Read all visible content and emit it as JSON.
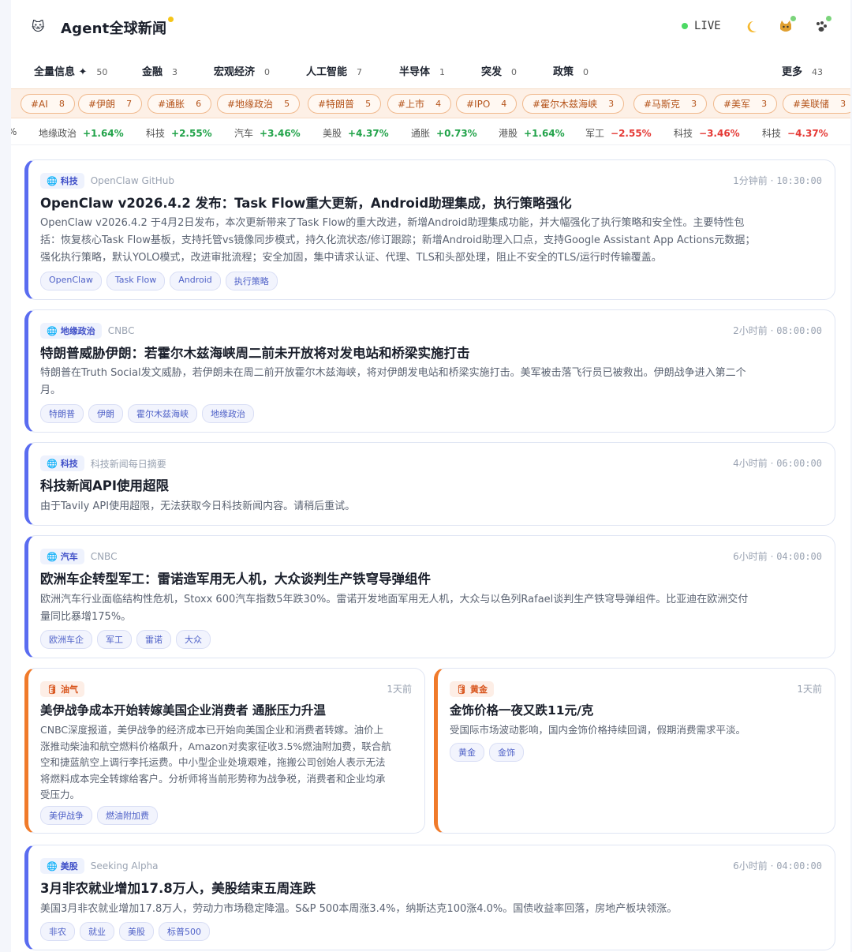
{
  "header": {
    "logo_icon": "🐱",
    "title": "Agent全球新闻",
    "live_label": "LIVE",
    "icons": [
      "moon-icon",
      "cat-icon",
      "paw-icon"
    ]
  },
  "categories": [
    {
      "label": "全量信息 ✦",
      "count": "50"
    },
    {
      "label": "金融",
      "count": "3"
    },
    {
      "label": "宏观经济",
      "count": "0"
    },
    {
      "label": "人工智能",
      "count": "7"
    },
    {
      "label": "半导体",
      "count": "1"
    },
    {
      "label": "突发",
      "count": "0"
    },
    {
      "label": "政策",
      "count": "0"
    },
    {
      "label": "更多",
      "count": "43"
    }
  ],
  "hashtags": [
    {
      "label": "#AI",
      "count": "8"
    },
    {
      "label": "#伊朗",
      "count": "7"
    },
    {
      "label": "#通胀",
      "count": "6"
    },
    {
      "label": "#地缘政治",
      "count": "5"
    },
    {
      "label": "#特朗普",
      "count": "5"
    },
    {
      "label": "#上市",
      "count": "4"
    },
    {
      "label": "#IPO",
      "count": "4"
    },
    {
      "label": "#霍尔木兹海峡",
      "count": "3"
    },
    {
      "label": "#马斯克",
      "count": "3"
    },
    {
      "label": "#美军",
      "count": "3"
    },
    {
      "label": "#美联储",
      "count": "3"
    }
  ],
  "ticker": [
    {
      "name": "%",
      "value": ""
    },
    {
      "name": "地缘政治",
      "value": "+1.64%",
      "color": "#22a34a"
    },
    {
      "name": "科技",
      "value": "+2.55%",
      "color": "#22a34a"
    },
    {
      "name": "汽车",
      "value": "+3.46%",
      "color": "#22a34a"
    },
    {
      "name": "美股",
      "value": "+4.37%",
      "color": "#22a34a"
    },
    {
      "name": "通胀",
      "value": "+0.73%",
      "color": "#22a34a"
    },
    {
      "name": "港股",
      "value": "+1.64%",
      "color": "#22a34a"
    },
    {
      "name": "军工",
      "value": "−2.55%",
      "color": "#e53935"
    },
    {
      "name": "科技",
      "value": "−3.46%",
      "color": "#e53935"
    },
    {
      "name": "科技",
      "value": "−4.37%",
      "color": "#e53935"
    }
  ],
  "cards": [
    {
      "category": "科技",
      "source": "OpenClaw GitHub",
      "time_ago": "1分钟前",
      "time": "10:30:00",
      "title": "OpenClaw v2026.4.2 发布：Task Flow重大更新，Android助理集成，执行策略强化",
      "lines": [
        "OpenClaw v2026.4.2 于4月2日发布，本次更新带来了Task Flow的重大改进，新增Android助理集成功能，并大幅强化了执行策略和安全性。主要特性包",
        "括：恢复核心Task Flow基板，支持托管vs镜像同步模式，持久化流状态/修订跟踪；新增Android助理入口点，支持Google Assistant App Actions元数据；",
        "强化执行策略，默认YOLO模式，改进审批流程；安全加固，集中请求认证、代理、TLS和头部处理，阻止不安全的TLS/运行时传输覆盖。"
      ],
      "tags": [
        "OpenClaw",
        "Task Flow",
        "Android",
        "执行策略"
      ]
    },
    {
      "category": "地缘政治",
      "source": "CNBC",
      "time_ago": "2小时前",
      "time": "08:00:00",
      "title": "特朗普威胁伊朗：若霍尔木兹海峡周二前未开放将对发电站和桥梁实施打击",
      "lines": [
        "特朗普在Truth Social发文威胁，若伊朗未在周二前开放霍尔木兹海峡，将对伊朗发电站和桥梁实施打击。美军被击落飞行员已被救出。伊朗战争进入第二个",
        "月。"
      ],
      "tags": [
        "特朗普",
        "伊朗",
        "霍尔木兹海峡",
        "地缘政治"
      ]
    },
    {
      "category": "科技",
      "source": "科技新闻每日摘要",
      "time_ago": "4小时前",
      "time": "06:00:00",
      "title": "科技新闻API使用超限",
      "lines": [
        "由于Tavily API使用超限，无法获取今日科技新闻内容。请稍后重试。"
      ],
      "tags": []
    },
    {
      "category": "汽车",
      "source": "CNBC",
      "time_ago": "6小时前",
      "time": "04:00:00",
      "title": "欧洲车企转型军工：雷诺造军用无人机，大众谈判生产铁穹导弹组件",
      "lines": [
        "欧洲汽车行业面临结构性危机，Stoxx 600汽车指数5年跌30%。雷诺开发地面军用无人机，大众与以色列Rafael谈判生产铁穹导弹组件。比亚迪在欧洲交付",
        "量同比暴增175%。"
      ],
      "tags": [
        "欧洲车企",
        "军工",
        "雷诺",
        "大众"
      ]
    },
    {
      "category": "油气",
      "source": "",
      "time_ago": "1天前",
      "time": "",
      "title": "美伊战争成本开始转嫁美国企业消费者 通胀压力升温",
      "lines": [
        "CNBC深度报道，美伊战争的经济成本已开始向美国企业和消费者转嫁。油价上",
        "涨推动柴油和航空燃料价格飙升，Amazon对卖家征收3.5%燃油附加费，联合航",
        "空和捷蓝航空上调行李托运费。中小型企业处境艰难，拖搬公司创始人表示无法",
        "将燃料成本完全转嫁给客户。分析师将当前形势称为战争税，消费者和企业均承",
        "受压力。"
      ],
      "tags": [
        "美伊战争",
        "燃油附加费"
      ]
    },
    {
      "category": "黄金",
      "source": "",
      "time_ago": "1天前",
      "time": "",
      "title": "金饰价格一夜又跌11元/克",
      "lines": [
        "受国际市场波动影响，国内金饰价格持续回调，假期消费需求平淡。"
      ],
      "tags": [
        "黄金",
        "金饰"
      ]
    },
    {
      "category": "美股",
      "source": "Seeking Alpha",
      "time_ago": "6小时前",
      "time": "04:00:00",
      "title": "3月非农就业增加17.8万人，美股结束五周连跌",
      "lines": [
        "美国3月非农就业增加17.8万人，劳动力市场稳定降温。S&P 500本周涨3.4%，纳斯达克100涨4.0%。国债收益率回落，房地产板块领涨。"
      ],
      "tags": [
        "非农",
        "就业",
        "美股",
        "标普500"
      ]
    }
  ],
  "colors": {
    "accent_blue": "#5a6cf0",
    "accent_orange": "#f07a2a",
    "up_green": "#22a34a",
    "down_red": "#e53935"
  }
}
